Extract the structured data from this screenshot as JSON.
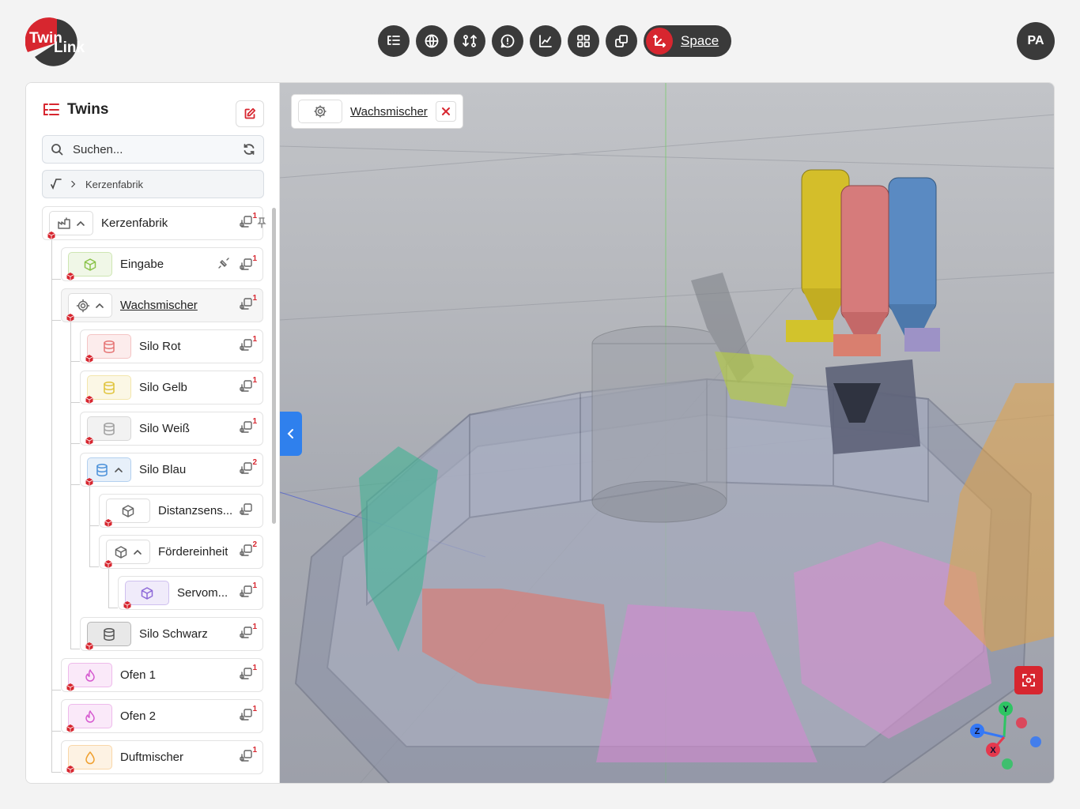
{
  "header": {
    "logo_text_1": "Twin",
    "logo_text_2": "Link",
    "toolbar_icons": [
      "tree-list-icon",
      "globe-icon",
      "routes-icon",
      "message-icon",
      "chart-icon",
      "dashboard-icon",
      "copy-icon"
    ],
    "space_label": "Space",
    "avatar_initials": "PA"
  },
  "sidebar": {
    "title": "Twins",
    "search_placeholder": "Suchen...",
    "breadcrumb_label": "Kerzenfabrik",
    "tree": [
      {
        "label": "Kerzenfabrik",
        "icon": "factory-icon",
        "count": "1",
        "expanded": true
      },
      {
        "label": "Eingabe",
        "icon": "cube-icon",
        "count": "1",
        "color": "#8bc34a"
      },
      {
        "label": "Wachsmischer",
        "icon": "gear-icon",
        "count": "1",
        "expanded": true,
        "active": true
      },
      {
        "label": "Silo Rot",
        "icon": "database-icon",
        "count": "1",
        "color": "#e57373"
      },
      {
        "label": "Silo Gelb",
        "icon": "database-icon",
        "count": "1",
        "color": "#e0c33a"
      },
      {
        "label": "Silo Weiß",
        "icon": "database-icon",
        "count": "1",
        "color": "#9e9e9e"
      },
      {
        "label": "Silo Blau",
        "icon": "database-icon",
        "count": "2",
        "color": "#4a90d9",
        "expanded": true
      },
      {
        "label": "Distanzsens...",
        "icon": "cube-icon",
        "count": ""
      },
      {
        "label": "Fördereinheit",
        "icon": "cube-icon",
        "count": "2",
        "expanded": true
      },
      {
        "label": "Servom...",
        "icon": "cube-icon",
        "count": "1",
        "color": "#8e6ad8"
      },
      {
        "label": "Silo Schwarz",
        "icon": "database-icon",
        "count": "1",
        "color": "#555555"
      },
      {
        "label": "Ofen 1",
        "icon": "flame-icon",
        "count": "1",
        "color": "#d65bd0"
      },
      {
        "label": "Ofen 2",
        "icon": "flame-icon",
        "count": "1",
        "color": "#d65bd0"
      },
      {
        "label": "Duftmischer",
        "icon": "drop-icon",
        "count": "1",
        "color": "#f0a030"
      }
    ]
  },
  "viewport": {
    "selected_tag": "Wachsmischer",
    "axes": {
      "y": "Y",
      "z": "Z",
      "x": "X"
    }
  },
  "colors": {
    "brand_red": "#d7262f",
    "dark": "#3a3a3a",
    "collapse_blue": "#2f80ed"
  }
}
